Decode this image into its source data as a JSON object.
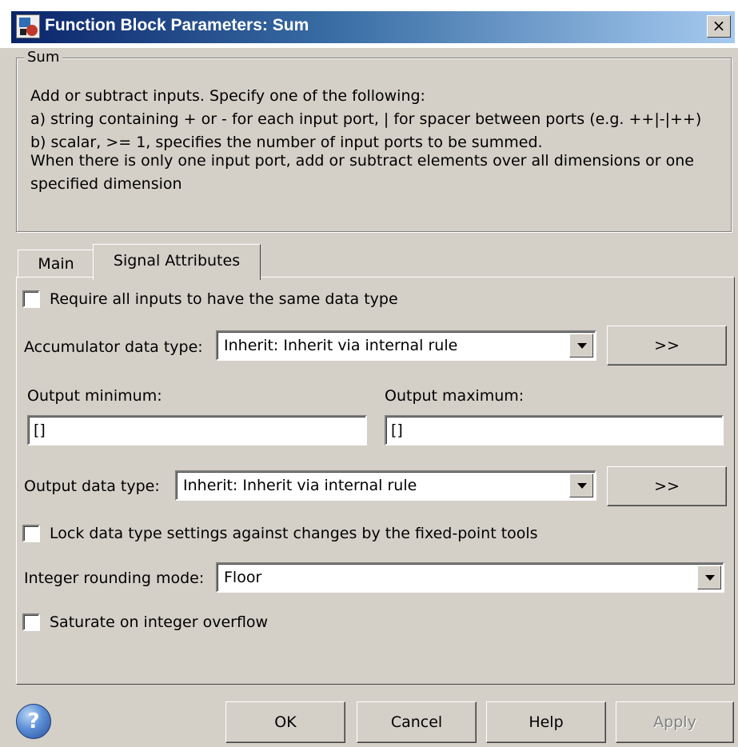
{
  "window": {
    "title": "Function Block Parameters: Sum",
    "close_label": "×"
  },
  "group": {
    "title": "Sum",
    "description_lines": [
      "Add or subtract inputs.  Specify one of the following:",
      "a) string containing + or - for each input port, | for spacer between ports (e.g. ++|-|++)",
      "b) scalar, >= 1, specifies the number of input ports to be summed.",
      "When there is only one input port, add or subtract elements over all dimensions or one",
      "specified dimension"
    ]
  },
  "tabs": [
    {
      "label": "Main",
      "active": false
    },
    {
      "label": "Signal Attributes",
      "active": true
    }
  ],
  "signal_attributes": {
    "require_same_type": {
      "label": "Require all inputs to have the same data type",
      "checked": false
    },
    "accumulator": {
      "label": "Accumulator data type:",
      "value": "Inherit: Inherit via internal rule",
      "assistant_label": ">>"
    },
    "output_minimum": {
      "label": "Output minimum:",
      "value": "[]"
    },
    "output_maximum": {
      "label": "Output maximum:",
      "value": "[]"
    },
    "output_data_type": {
      "label": "Output data type:",
      "value": "Inherit: Inherit via internal rule",
      "assistant_label": ">>"
    },
    "lock_data_type": {
      "label": "Lock data type settings against changes by the fixed-point tools",
      "checked": false
    },
    "rounding_mode": {
      "label": "Integer rounding mode:",
      "value": "Floor"
    },
    "saturate": {
      "label": "Saturate on integer overflow",
      "checked": false
    }
  },
  "footer": {
    "help_icon": "question-mark-icon",
    "ok_label": "OK",
    "cancel_label": "Cancel",
    "help_label": "Help",
    "apply_label": "Apply",
    "apply_enabled": false
  }
}
